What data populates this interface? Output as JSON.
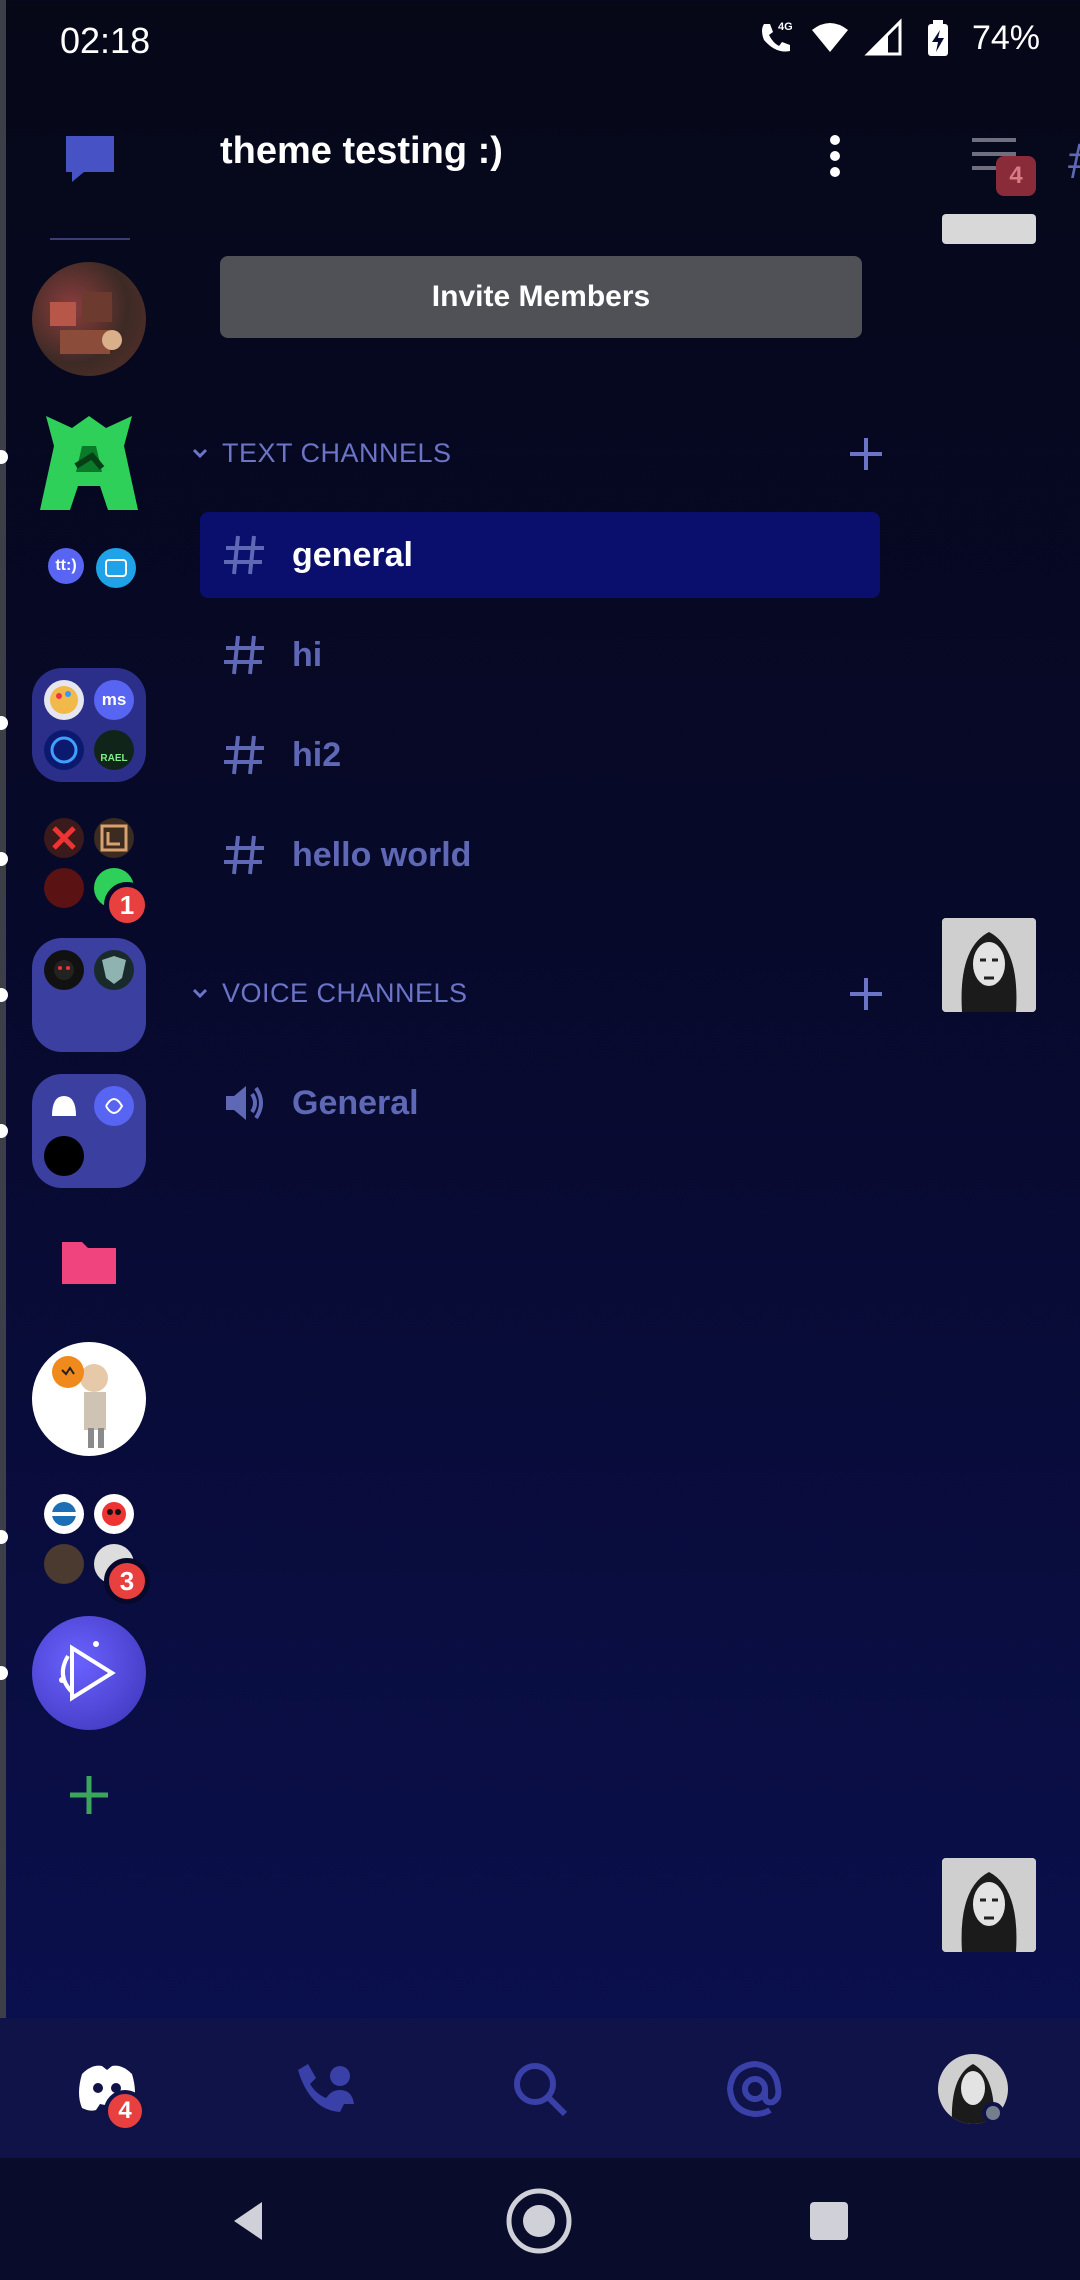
{
  "status_bar": {
    "time": "02:18",
    "battery": "74%",
    "network": "4G"
  },
  "guild": {
    "name": "theme testing :)",
    "invite_label": "Invite Members"
  },
  "categories": [
    {
      "label": "TEXT CHANNELS"
    },
    {
      "label": "VOICE CHANNELS"
    }
  ],
  "text_channels": [
    {
      "label": "general"
    },
    {
      "label": "hi"
    },
    {
      "label": "hi2"
    },
    {
      "label": "hello world"
    }
  ],
  "voice_channels": [
    {
      "label": "General"
    }
  ],
  "server_rail": {
    "dm_icon": "chat-bubble-icon",
    "folder_small_label": "tt:)",
    "folder_ms_label": "ms",
    "folder_rael_label": "RAEL",
    "badge_folder_a": "1",
    "badge_folder_b": "3"
  },
  "peek": {
    "member_badge": "4"
  },
  "tabbar": {
    "items": [
      "home-icon",
      "friends-icon",
      "search-icon",
      "mentions-icon",
      "profile-icon"
    ],
    "home_badge": "4"
  },
  "colors": {
    "accent": "#5865f2",
    "active_channel": "#0a0e6c",
    "badge": "#e8403f",
    "add_green": "#3ba55c",
    "folder_pink": "#f0447f"
  }
}
